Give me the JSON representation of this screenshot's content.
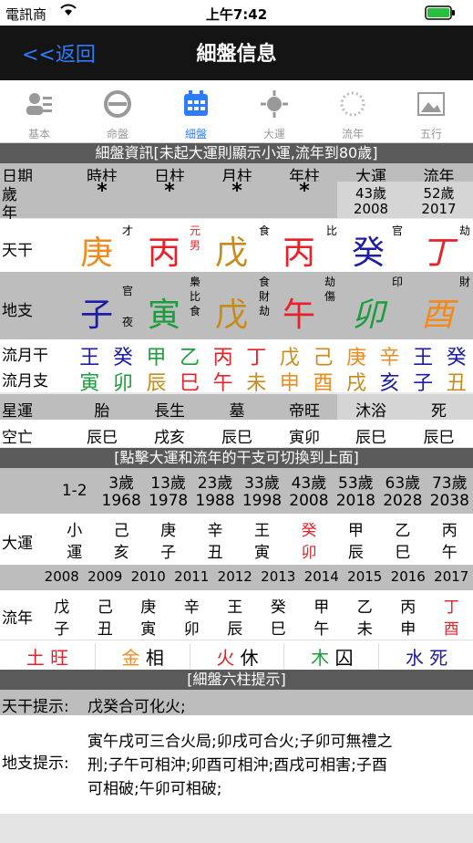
{
  "status_bar": {
    "carrier": "電訊商",
    "time": "上午7:42"
  },
  "nav": {
    "back": "<<返回",
    "title": "細盤信息"
  },
  "tabs": [
    {
      "label": "基本",
      "icon": "person-card-icon"
    },
    {
      "label": "命盤",
      "icon": "disk-icon"
    },
    {
      "label": "細盤",
      "icon": "calendar-icon"
    },
    {
      "label": "大運",
      "icon": "sun-icon"
    },
    {
      "label": "流年",
      "icon": "dotted-circle-icon"
    },
    {
      "label": "五行",
      "icon": "picture-icon"
    }
  ],
  "section1": "細盤資訊[未起大運則顯示小運,流年到80歲]",
  "header": {
    "date": "日期",
    "sui": "歲",
    "nian": "年",
    "hour": "時柱",
    "day": "日柱",
    "month": "月柱",
    "year": "年柱",
    "dayun": "大運",
    "liunian": "流年"
  },
  "stars": [
    "*",
    "*",
    "*",
    "*"
  ],
  "dayun_age": "43歲",
  "dayun_year": "2008",
  "liunian_age": "52歲",
  "liunian_year": "2017",
  "tiangan": {
    "label": "天干",
    "chars": [
      "庚",
      "丙",
      "戊",
      "丙",
      "癸",
      "丁"
    ],
    "sups": [
      "才",
      "元",
      "食",
      "比",
      "官",
      "劫"
    ],
    "sup2": "男"
  },
  "dizhi": {
    "label": "地支",
    "chars": [
      "子",
      "寅",
      "戊",
      "午",
      "卯",
      "酉"
    ],
    "hidden": [
      [
        "官",
        "夜"
      ],
      [
        "梟",
        "比",
        "食"
      ],
      [
        "食",
        "財",
        "劫"
      ],
      [
        "劫",
        "傷"
      ],
      [
        "印"
      ],
      [
        "財"
      ]
    ]
  },
  "liuyuegan": {
    "label": "流月干",
    "chars": [
      "王",
      "癸",
      "甲",
      "乙",
      "丙",
      "丁",
      "戊",
      "己",
      "庚",
      "辛",
      "王",
      "癸"
    ]
  },
  "liuyuezhi": {
    "label": "流月支",
    "chars": [
      "寅",
      "卯",
      "辰",
      "巳",
      "午",
      "未",
      "申",
      "酉",
      "戌",
      "亥",
      "子",
      "丑"
    ]
  },
  "xingyun": {
    "label": "星運",
    "vals": [
      "胎",
      "長生",
      "墓",
      "帝旺",
      "沐浴",
      "死"
    ]
  },
  "kongwang": {
    "label": "空亡",
    "vals": [
      "辰巳",
      "戌亥",
      "辰巳",
      "寅卯",
      "辰巳",
      "辰巳"
    ]
  },
  "section2": "[點擊大運和流年的干支可切換到上面]",
  "dayun_ages": [
    "1-2",
    "3歲",
    "13歲",
    "23歲",
    "33歲",
    "43歲",
    "53歲",
    "63歲",
    "73歲"
  ],
  "dayun_years": [
    "",
    "1968",
    "1978",
    "1988",
    "1998",
    "2008",
    "2018",
    "2028",
    "2038"
  ],
  "dayun": {
    "label": "大運",
    "gan": [
      "小",
      "己",
      "庚",
      "辛",
      "王",
      "癸",
      "甲",
      "乙",
      "丙"
    ],
    "zhi": [
      "運",
      "亥",
      "子",
      "丑",
      "寅",
      "卯",
      "辰",
      "巳",
      "午"
    ]
  },
  "liunian_years": [
    "2008",
    "2009",
    "2010",
    "2011",
    "2012",
    "2013",
    "2014",
    "2015",
    "2016",
    "2017"
  ],
  "liunian": {
    "label": "流年",
    "gan": [
      "戊",
      "己",
      "庚",
      "辛",
      "王",
      "癸",
      "甲",
      "乙",
      "丙",
      "丁"
    ],
    "zhi": [
      "子",
      "丑",
      "寅",
      "卯",
      "辰",
      "巳",
      "午",
      "未",
      "申",
      "酉"
    ]
  },
  "wuxing": [
    [
      "土",
      "旺"
    ],
    [
      "金",
      "相"
    ],
    [
      "火",
      "休"
    ],
    [
      "木",
      "囚"
    ],
    [
      "水",
      "死"
    ]
  ],
  "section3": "[細盤六柱提示]",
  "tiangan_tip": {
    "label": "天干提示:",
    "text": "戊癸合可化火;"
  },
  "dizhi_tip": {
    "label": "地支提示:",
    "line1": "寅午戌可三合火局;卯戌可合火;子卯可無禮之",
    "line2": "刑;子午可相沖;卯酉可相沖;酉戌可相害;子酉",
    "line3": "可相破;午卯可相破;"
  },
  "colors": {
    "fire": "#e8202a",
    "earth": "#c88a1a",
    "wood": "#1a9d3a",
    "water": "#1c1ca8",
    "metal": "#f08a1c",
    "accent": "#2c7cff"
  }
}
